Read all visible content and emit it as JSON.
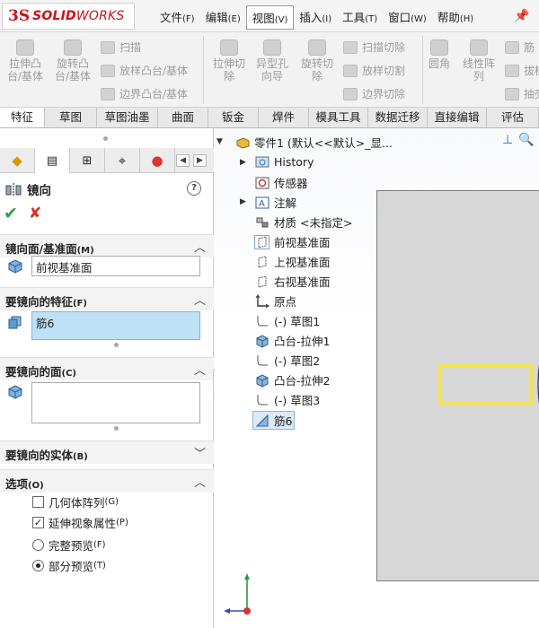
{
  "app": {
    "logo_mark": "3S",
    "logo_text_bold": "SOLID",
    "logo_text_rest": "WORKS"
  },
  "menu": [
    {
      "label": "文件",
      "key": "(F)"
    },
    {
      "label": "编辑",
      "key": "(E)"
    },
    {
      "label": "视图",
      "key": "(V)"
    },
    {
      "label": "插入",
      "key": "(I)"
    },
    {
      "label": "工具",
      "key": "(T)"
    },
    {
      "label": "窗口",
      "key": "(W)"
    },
    {
      "label": "帮助",
      "key": "(H)"
    }
  ],
  "ribbon": {
    "extrude_boss": "拉伸凸台/基体",
    "revolve_boss": "旋转凸台/基体",
    "sweep": "扫描",
    "loft_boss": "放样凸台/基体",
    "boundary_boss": "边界凸台/基体",
    "extrude_cut": "拉伸切除",
    "hole_wizard": "异型孔向导",
    "revolve_cut": "旋转切除",
    "swept_cut": "扫描切除",
    "lofted_cut": "放样切割",
    "boundary_cut": "边界切除",
    "fillet": "圆角",
    "linear_pattern": "线性阵列",
    "rib": "筋",
    "draft": "拔模",
    "shell": "抽壳"
  },
  "tabs": [
    "特征",
    "草图",
    "草图油墨",
    "曲面",
    "钣金",
    "焊件",
    "模具工具",
    "数据迁移",
    "直接编辑",
    "评估"
  ],
  "property_manager": {
    "title": "镜向",
    "help": "?",
    "ok_glyph": "✔",
    "cancel_glyph": "✘",
    "plane_group": {
      "title": "镜向面/基准面",
      "key": "(M)",
      "value": "前视基准面"
    },
    "features_group": {
      "title": "要镜向的特征",
      "key": "(F)",
      "value": "筋6"
    },
    "faces_group": {
      "title": "要镜向的面",
      "key": "(C)",
      "value": ""
    },
    "bodies_group": {
      "title": "要镜向的实体",
      "key": "(B)"
    },
    "options_group": {
      "title": "选项",
      "key": "(O)",
      "geometry_pattern": {
        "label": "几何体阵列",
        "key": "(G)",
        "checked": false
      },
      "propagate_visual": {
        "label": "延伸视象属性",
        "key": "(P)",
        "checked": true
      },
      "full_preview": {
        "label": "完整预览",
        "key": "(F)",
        "selected": false
      },
      "partial_preview": {
        "label": "部分预览",
        "key": "(T)",
        "selected": true
      }
    }
  },
  "tree": {
    "root": "零件1  (默认<<默认>_显...",
    "items": [
      {
        "label": "History"
      },
      {
        "label": "传感器"
      },
      {
        "label": "注解"
      },
      {
        "label": "材质 <未指定>"
      },
      {
        "label": "前视基准面"
      },
      {
        "label": "上视基准面"
      },
      {
        "label": "右视基准面"
      },
      {
        "label": "原点"
      },
      {
        "label": "(-) 草图1"
      },
      {
        "label": "凸台-拉伸1"
      },
      {
        "label": "(-) 草图2"
      },
      {
        "label": "凸台-拉伸2"
      },
      {
        "label": "(-) 草图3"
      },
      {
        "label": "筋6"
      }
    ]
  },
  "colors": {
    "brand_red": "#d10e17",
    "ok_green": "#2ea043",
    "cancel_red": "#d93025",
    "selection_blue": "#bfe0f5",
    "preview_yellow": "#f1e34a"
  }
}
